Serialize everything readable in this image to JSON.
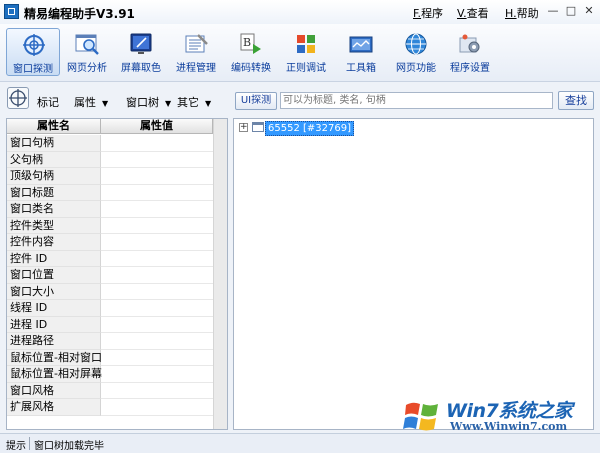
{
  "window": {
    "title": "精易编程助手V3.91",
    "menus": [
      {
        "key": "F.",
        "label": "程序"
      },
      {
        "key": "V.",
        "label": "查看"
      },
      {
        "key": "H.",
        "label": "帮助"
      }
    ],
    "controls": {
      "minimize": "—",
      "maximize": "□",
      "close": "✕"
    }
  },
  "toolbar": {
    "buttons": [
      {
        "label": "窗口探测",
        "icon": "crosshair-icon",
        "active": true
      },
      {
        "label": "网页分析",
        "icon": "web-analysis-icon"
      },
      {
        "label": "屏幕取色",
        "icon": "color-picker-icon"
      },
      {
        "label": "进程管理",
        "icon": "process-manager-icon"
      },
      {
        "label": "编码转换",
        "icon": "encoding-icon"
      },
      {
        "label": "正则调试",
        "icon": "regex-icon"
      },
      {
        "label": "工具箱",
        "icon": "toolbox-icon"
      },
      {
        "label": "网页功能",
        "icon": "globe-icon"
      },
      {
        "label": "程序设置",
        "icon": "settings-icon"
      }
    ]
  },
  "filterbar": {
    "mark_label": "标记",
    "property_menu": "属性",
    "window_tree_menu": "窗口树",
    "other_menu": "其它",
    "ui_probe_button": "UI探测",
    "search_placeholder": "可以为标题, 类名, 句柄",
    "search_button": "查找"
  },
  "property_grid": {
    "headers": {
      "name": "属性名",
      "value": "属性值"
    },
    "rows": [
      {
        "name": "窗口句柄",
        "value": ""
      },
      {
        "name": "父句柄",
        "value": ""
      },
      {
        "name": "顶级句柄",
        "value": ""
      },
      {
        "name": "窗口标题",
        "value": ""
      },
      {
        "name": "窗口类名",
        "value": ""
      },
      {
        "name": "控件类型",
        "value": ""
      },
      {
        "name": "控件内容",
        "value": ""
      },
      {
        "name": "控件 ID",
        "value": ""
      },
      {
        "name": "窗口位置",
        "value": ""
      },
      {
        "name": "窗口大小",
        "value": ""
      },
      {
        "name": "线程 ID",
        "value": ""
      },
      {
        "name": "进程 ID",
        "value": ""
      },
      {
        "name": "进程路径",
        "value": ""
      },
      {
        "name": "鼠标位置-相对窗口",
        "value": ""
      },
      {
        "name": "鼠标位置-相对屏幕",
        "value": ""
      },
      {
        "name": "窗口风格",
        "value": ""
      },
      {
        "name": "扩展风格",
        "value": ""
      }
    ]
  },
  "tree": {
    "nodes": [
      {
        "label": "65552 [#32769]",
        "expander": "+"
      }
    ]
  },
  "watermark": {
    "brand": "Win7系统之家",
    "url": "Www.Winwin7.com"
  },
  "statusbar": {
    "label": "提示",
    "message": "窗口树加载完毕"
  },
  "colors": {
    "accent": "#0a3c9c",
    "selection": "#3399ff",
    "panel_bg": "#eef2f8"
  }
}
